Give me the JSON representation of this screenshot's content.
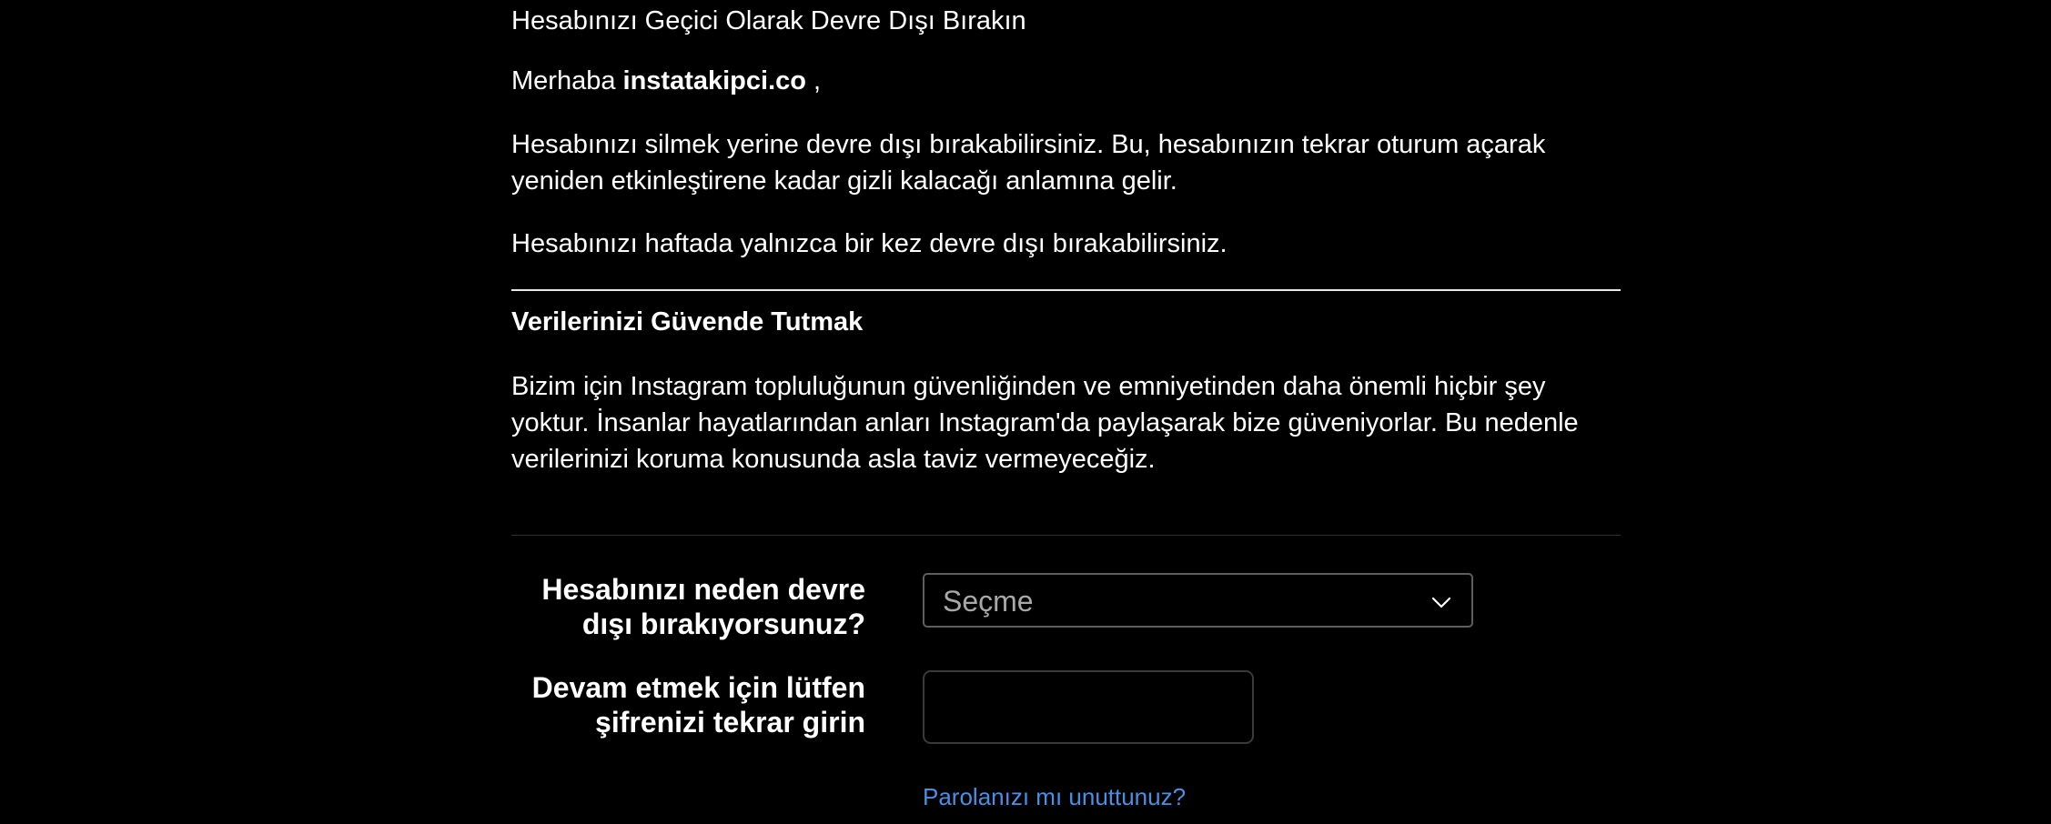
{
  "page": {
    "heading": "Hesabınızı Geçici Olarak Devre Dışı Bırakın",
    "greeting_prefix": "Merhaba ",
    "username": "instatakipci.co",
    "greeting_suffix": " ,",
    "intro_paragraph": "Hesabınızı silmek yerine devre dışı bırakabilirsiniz. Bu, hesabınızın tekrar oturum açarak yeniden etkinleştirene kadar gizli kalacağı anlamına gelir.",
    "frequency_note": "Hesabınızı haftada yalnızca bir kez devre dışı bırakabilirsiniz."
  },
  "security_section": {
    "title": "Verilerinizi Güvende Tutmak",
    "body": "Bizim için Instagram topluluğunun güvenliğinden ve emniyetinden daha önemli hiçbir şey yoktur. İnsanlar hayatlarından anları Instagram'da paylaşarak bize güveniyorlar. Bu nedenle verilerinizi koruma konusunda asla taviz vermeyeceğiz."
  },
  "form": {
    "reason_label": "Hesabınızı neden devre dışı bırakıyorsunuz?",
    "reason_selected": "Seçme",
    "password_label": "Devam etmek için lütfen şifrenizi tekrar girin",
    "password_value": "",
    "forgot_password_link": "Parolanızı mı unuttunuz?"
  },
  "colors": {
    "background": "#000000",
    "text": "#ffffff",
    "link": "#4a90e2",
    "placeholder_text": "#a8a8a8",
    "select_border": "#5e5e5e"
  },
  "icons": {
    "select_indicator": "chevron-down-icon"
  }
}
